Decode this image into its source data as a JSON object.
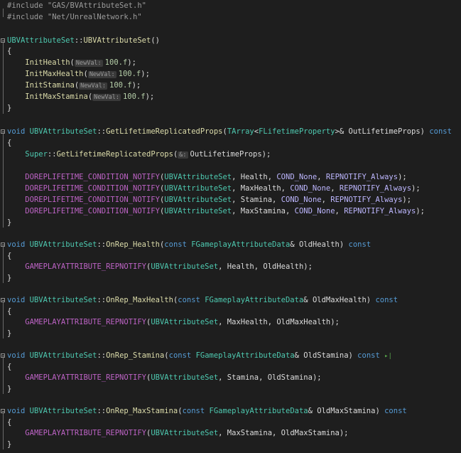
{
  "editor": {
    "include1": "#include \"GAS/BVAttributeSet.h\"",
    "include2": "#include \"Net/UnrealNetwork.h\"",
    "ctor_class": "UBVAttributeSet",
    "ctor_sep": "::",
    "ctor_name": "UBVAttributeSet",
    "ctor_parens": "()",
    "brace_open": "{",
    "brace_close": "}",
    "init_lines": [
      {
        "fn": "InitHealth",
        "hint": "NewVal:",
        "val": "100.f",
        "tail": ");"
      },
      {
        "fn": "InitMaxHealth",
        "hint": "NewVal:",
        "val": "100.f",
        "tail": ");"
      },
      {
        "fn": "InitStamina",
        "hint": "NewVal:",
        "val": "100.f",
        "tail": ");"
      },
      {
        "fn": "InitMaxStamina",
        "hint": "NewVal:",
        "val": "100.f",
        "tail": ");"
      }
    ],
    "glrp": {
      "kw_void": "void",
      "cls": "UBVAttributeSet",
      "name": "GetLifetimeReplicatedProps",
      "param_type1": "TArray",
      "param_type2": "FLifetimeProperty",
      "param_rest": "& OutLifetimeProps)",
      "kw_const": "const",
      "super": "Super",
      "super_fn": "GetLifetimeReplicatedProps",
      "super_hint": "&:",
      "super_arg": "OutLifetimeProps",
      "macro": "DOREPLIFETIME_CONDITION_NOTIFY",
      "rows": [
        {
          "attr": "Health",
          "cond": "COND_None",
          "rep": "REPNOTIFY_Always"
        },
        {
          "attr": "MaxHealth",
          "cond": "COND_None",
          "rep": "REPNOTIFY_Always"
        },
        {
          "attr": "Stamina",
          "cond": "COND_None",
          "rep": "REPNOTIFY_Always"
        },
        {
          "attr": "MaxStamina",
          "cond": "COND_None",
          "rep": "REPNOTIFY_Always"
        }
      ]
    },
    "onrep_macro": "GAMEPLAYATTRIBUTE_REPNOTIFY",
    "onrep_type": "FGameplayAttributeData",
    "onreps": [
      {
        "name": "OnRep_Health",
        "param": "OldHealth",
        "attr": "Health"
      },
      {
        "name": "OnRep_MaxHealth",
        "param": "OldMaxHealth",
        "attr": "MaxHealth"
      },
      {
        "name": "OnRep_Stamina",
        "param": "OldStamina",
        "attr": "Stamina"
      },
      {
        "name": "OnRep_MaxStamina",
        "param": "OldMaxStamina",
        "attr": "MaxStamina"
      }
    ],
    "colors": {
      "background": "#1e1e1e",
      "class": "#4ec9b0",
      "function": "#dcdcaa",
      "keyword": "#569cd6",
      "macro": "#bd63c5",
      "string": "#d69d85"
    }
  }
}
